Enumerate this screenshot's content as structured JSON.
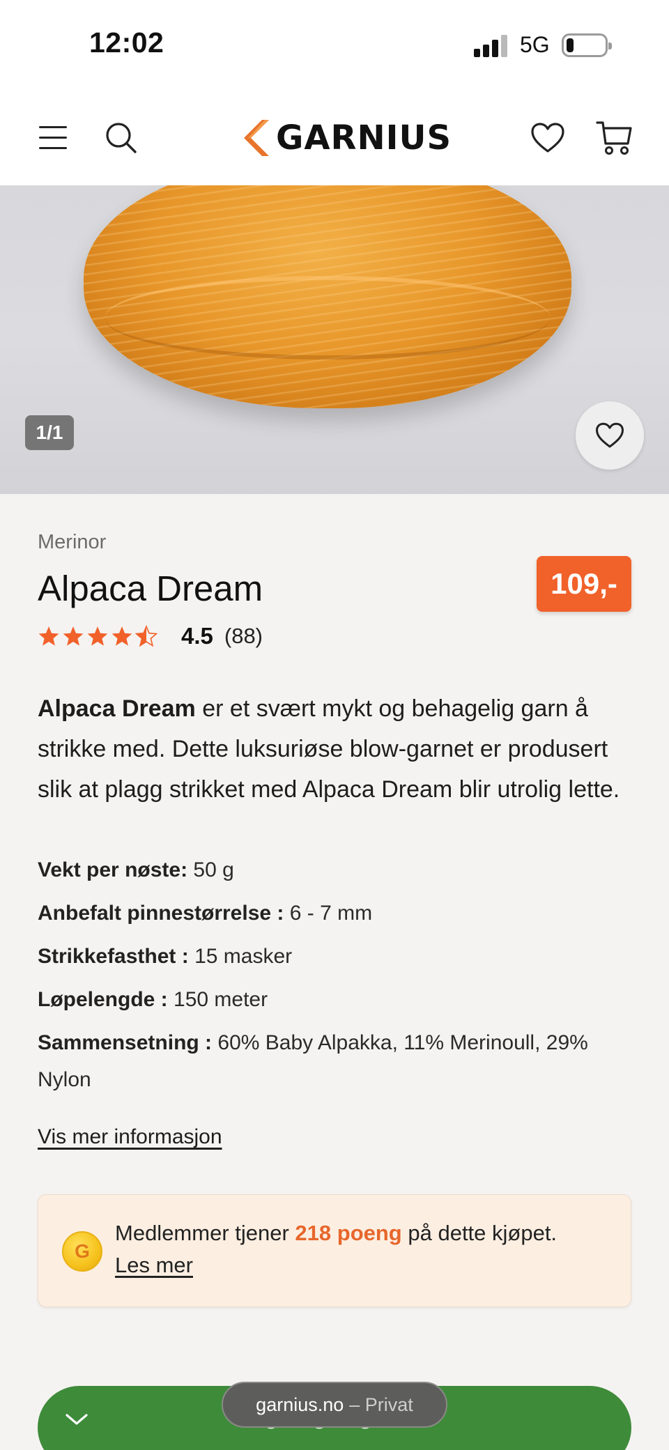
{
  "status_bar": {
    "time": "12:02",
    "network": "5G",
    "battery_level": 0.2
  },
  "header": {
    "logo_text": "GARNIUS",
    "icons": [
      "menu-icon",
      "search-icon",
      "heart-icon",
      "cart-icon"
    ]
  },
  "gallery": {
    "counter": "1/1"
  },
  "product": {
    "brand": "Merinor",
    "title": "Alpaca Dream",
    "price": "109,-",
    "rating": {
      "value": "4.5",
      "count": "(88)",
      "stars": 4.5
    },
    "description": {
      "bold": "Alpaca Dream",
      "rest": " er et svært mykt og behagelig garn å strikke med. Dette luksuriøse blow-garnet er produsert slik at plagg strikket med Alpaca Dream blir utrolig lette."
    },
    "specs": [
      {
        "label": "Vekt per nøste:",
        "value": " 50 g"
      },
      {
        "label": "Anbefalt pinnestørrelse :",
        "value": " 6 - 7 mm"
      },
      {
        "label": "Strikkefasthet :",
        "value": " 15 masker"
      },
      {
        "label": "Løpelengde :",
        "value": " 150 meter"
      },
      {
        "label": "Sammensetning :",
        "value": " 60% Baby Alpakka, 11% Merinoull, 29% Nylon"
      }
    ],
    "more_info_link": "Vis mer informasjon"
  },
  "points": {
    "prefix": "Medlemmer tjener ",
    "highlight": "218 poeng",
    "suffix": " på dette kjøpet.",
    "link": "Les mer",
    "coin_letter": "G"
  },
  "cta": {
    "label": "Velg farge og antall"
  },
  "browser": {
    "domain": "garnius.no",
    "mode": "– Privat"
  },
  "colors": {
    "accent": "#f1612a",
    "cta_green": "#3e8b3a",
    "points_bg": "#fcefe2",
    "page_bg": "#f5f3f1"
  }
}
